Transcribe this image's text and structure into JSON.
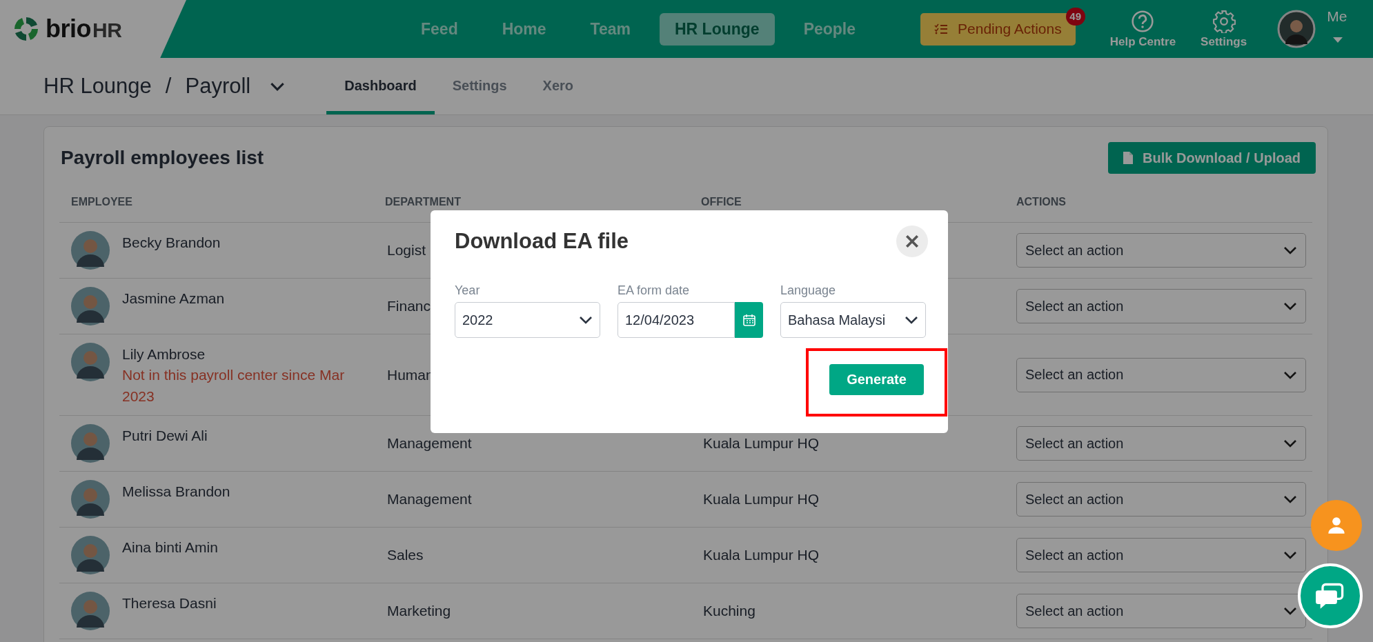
{
  "topbar": {
    "logo": {
      "brand": "brio",
      "suffix": "HR"
    },
    "nav": [
      {
        "label": "Feed",
        "selected": false
      },
      {
        "label": "Home",
        "selected": false
      },
      {
        "label": "Team",
        "selected": false
      },
      {
        "label": "HR Lounge",
        "selected": true
      },
      {
        "label": "People",
        "selected": false
      }
    ],
    "pending": {
      "label": "Pending Actions",
      "badge": "49"
    },
    "tools": [
      {
        "kind": "help",
        "label": "Help Centre"
      },
      {
        "kind": "settings",
        "label": "Settings"
      }
    ],
    "user": {
      "label": "Me"
    }
  },
  "breadcrumb": {
    "items": [
      "HR Lounge",
      "Payroll"
    ],
    "separator": "/"
  },
  "tabs": [
    {
      "label": "Dashboard",
      "selected": true
    },
    {
      "label": "Settings",
      "selected": false
    },
    {
      "label": "Xero",
      "selected": false
    }
  ],
  "card": {
    "title": "Payroll employees list",
    "bulk_button": "Bulk Download / Upload",
    "columns": [
      "EMPLOYEE",
      "DEPARTMENT",
      "OFFICE",
      "ACTIONS"
    ],
    "rows": [
      {
        "employee": "Becky Brandon",
        "department": "Logist",
        "action": "Select an action"
      },
      {
        "employee": "Jasmine Azman",
        "department": "Financ",
        "action": "Select an action"
      },
      {
        "employee": "Lily Ambrose",
        "note": "Not in this payroll center since Mar 2023",
        "department": "Human",
        "action": "Select an action"
      },
      {
        "employee": "Putri Dewi Ali",
        "department": "Management",
        "office": "Kuala Lumpur HQ",
        "action": "Select an action"
      },
      {
        "employee": "Melissa Brandon",
        "department": "Management",
        "office": "Kuala Lumpur HQ",
        "action": "Select an action"
      },
      {
        "employee": "Aina binti Amin",
        "department": "Sales",
        "office": "Kuala Lumpur HQ",
        "action": "Select an action"
      },
      {
        "employee": "Theresa Dasni",
        "department": "Marketing",
        "office": "Kuching",
        "action": "Select an action"
      }
    ]
  },
  "modal": {
    "title": "Download EA file",
    "fields": [
      {
        "kind": "select",
        "label": "Year",
        "value": "2022"
      },
      {
        "kind": "date",
        "label": "EA form date",
        "value": "12/04/2023"
      },
      {
        "kind": "select",
        "label": "Language",
        "value": "Bahasa Malaysi"
      }
    ],
    "button": {
      "label": "Generate",
      "highlighted": true
    }
  }
}
